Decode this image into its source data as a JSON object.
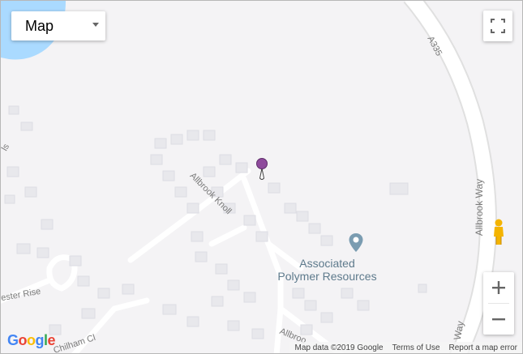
{
  "map_type": {
    "label": "Map"
  },
  "roads": {
    "a335": "A335",
    "allbrook_way": "Allbrook Way",
    "allbrook_way_lower": "Way",
    "allbrook_knoll": "Allbrook Knoll",
    "allbrook_bottom": "Allbroo",
    "chilham_cl": "Chilham Cl",
    "ester_rise": "ester Rise",
    "left_edge": "ls"
  },
  "poi": {
    "line1": "Associated",
    "line2": "Polymer Resources"
  },
  "footer": {
    "map_data": "Map data ©2019 Google",
    "terms": "Terms of Use",
    "report": "Report a map error"
  },
  "logo": {
    "letters": [
      "G",
      "o",
      "o",
      "g",
      "l",
      "e"
    ],
    "colors": [
      "#4285F4",
      "#EA4335",
      "#FBBC05",
      "#4285F4",
      "#34A853",
      "#EA4335"
    ]
  },
  "colors": {
    "marker": "#8e4a9c",
    "poi_pin": "#7a9cb1",
    "water": "#aadaff",
    "pegman": "#f4b400"
  },
  "controls": {
    "zoom_in": "+",
    "zoom_out": "−"
  }
}
